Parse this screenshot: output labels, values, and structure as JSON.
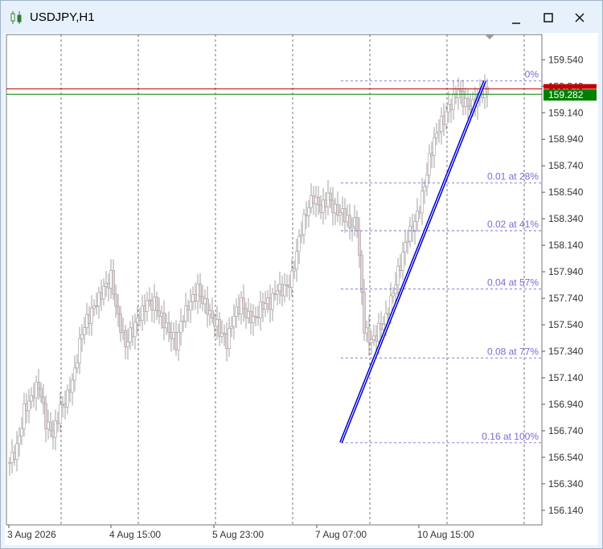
{
  "window": {
    "title": "USDJPY,H1",
    "minimize_icon": "minimize-icon",
    "maximize_icon": "maximize-icon",
    "close_icon": "close-icon"
  },
  "price_axis": {
    "ticks": [
      "159.540",
      "159.340",
      "159.140",
      "158.940",
      "158.740",
      "158.540",
      "158.340",
      "158.140",
      "157.940",
      "157.740",
      "157.540",
      "157.340",
      "157.140",
      "156.940",
      "156.740",
      "156.540",
      "156.340",
      "156.140"
    ],
    "current_price_label": "159.282",
    "current_price_color": "#008000",
    "red_line_color": "#c00000"
  },
  "time_axis": {
    "labels": [
      "3 Aug 2026",
      "4 Aug 15:00",
      "5 Aug 23:00",
      "7 Aug 07:00",
      "10 Aug 15:00"
    ]
  },
  "fibonacci": {
    "line_color": "#0000cc",
    "level_color": "#7b6bd6",
    "levels": [
      {
        "label": "0%",
        "price": 159.38
      },
      {
        "label": "0.01 at 28%",
        "price": 158.61
      },
      {
        "label": "0.02 at 41%",
        "price": 158.25
      },
      {
        "label": "0.04 at 57%",
        "price": 157.81
      },
      {
        "label": "0.08 at 77%",
        "price": 157.29
      },
      {
        "label": "0.16 at 100%",
        "price": 156.65
      }
    ]
  },
  "chart_data": {
    "type": "candlestick",
    "symbol": "USDJPY",
    "timeframe": "H1",
    "ylim": [
      156.03,
      159.73
    ],
    "grid": true,
    "close_series_approx": [
      156.5,
      156.6,
      156.9,
      157.0,
      157.1,
      156.8,
      156.7,
      156.9,
      157.0,
      157.2,
      157.5,
      157.6,
      157.7,
      157.8,
      157.9,
      157.6,
      157.4,
      157.5,
      157.6,
      157.7,
      157.7,
      157.6,
      157.5,
      157.4,
      157.6,
      157.7,
      157.8,
      157.7,
      157.6,
      157.5,
      157.4,
      157.6,
      157.7,
      157.6,
      157.6,
      157.7,
      157.7,
      157.8,
      157.8,
      157.9,
      158.2,
      158.4,
      158.5,
      158.4,
      158.5,
      158.4,
      158.4,
      158.3,
      158.3,
      157.5,
      157.4,
      157.5,
      157.6,
      157.8,
      158.0,
      158.2,
      158.3,
      158.5,
      158.8,
      159.0,
      159.1,
      159.2,
      159.3,
      159.2,
      159.2,
      159.3,
      159.28
    ]
  }
}
